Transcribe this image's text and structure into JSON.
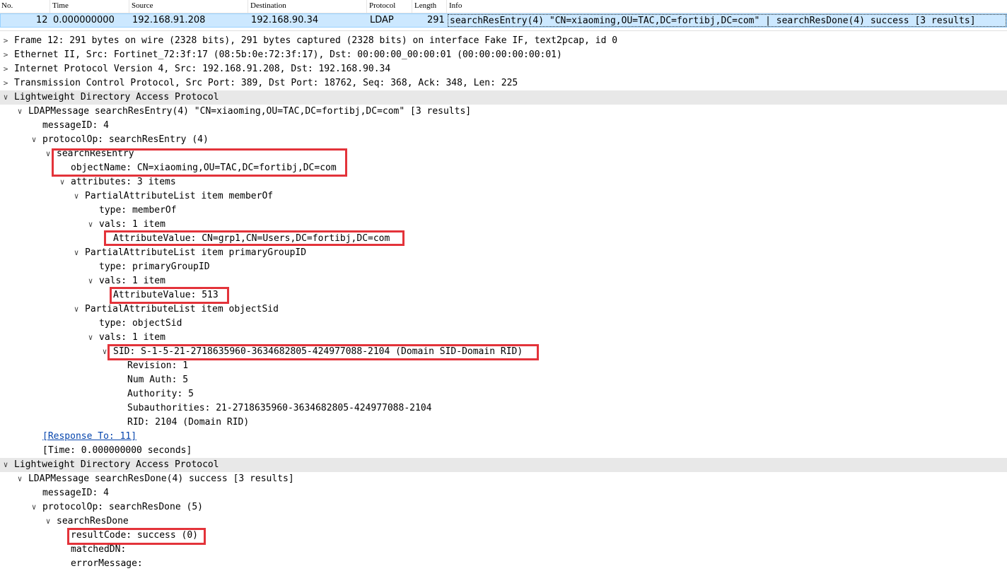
{
  "packet_list": {
    "headers": [
      "No.",
      "Time",
      "Source",
      "Destination",
      "Protocol",
      "Length",
      "Info"
    ],
    "selected_row": {
      "no": "12",
      "time": "0.000000000",
      "source": "192.168.91.208",
      "destination": "192.168.90.34",
      "protocol": "LDAP",
      "length": "291",
      "info": "searchResEntry(4) \"CN=xiaoming,OU=TAC,DC=fortibj,DC=com\"  | searchResDone(4) success  [3 results]"
    },
    "selected_bg": "#cce8ff"
  },
  "details": {
    "frame": "Frame 12: 291 bytes on wire (2328 bits), 291 bytes captured (2328 bits) on interface Fake IF, text2pcap, id 0",
    "ethernet": "Ethernet II, Src: Fortinet_72:3f:17 (08:5b:0e:72:3f:17), Dst: 00:00:00_00:00:01 (00:00:00:00:00:01)",
    "ip": "Internet Protocol Version 4, Src: 192.168.91.208, Dst: 192.168.90.34",
    "tcp": "Transmission Control Protocol, Src Port: 389, Dst Port: 18762, Seq: 368, Ack: 348, Len: 225",
    "ldap1": "Lightweight Directory Access Protocol",
    "ldap1_msg": "LDAPMessage searchResEntry(4) \"CN=xiaoming,OU=TAC,DC=fortibj,DC=com\" [3 results]",
    "ldap1_msgid": "messageID: 4",
    "ldap1_protocolop": "protocolOp: searchResEntry (4)",
    "search_res_entry": "searchResEntry",
    "object_name": "objectName: CN=xiaoming,OU=TAC,DC=fortibj,DC=com",
    "attributes": "attributes: 3 items",
    "pal_memberof": "PartialAttributeList item memberOf",
    "type_memberof": "type: memberOf",
    "vals1": "vals: 1 item",
    "attr_value_group": "AttributeValue: CN=grp1,CN=Users,DC=fortibj,DC=com",
    "pal_primarygroup": "PartialAttributeList item primaryGroupID",
    "type_primarygroup": "type: primaryGroupID",
    "vals2": "vals: 1 item",
    "attr_value_513": "AttributeValue: 513",
    "pal_objectsid": "PartialAttributeList item objectSid",
    "type_objectsid": "type: objectSid",
    "vals3": "vals: 1 item",
    "sid": "SID: S-1-5-21-2718635960-3634682805-424977088-2104  (Domain SID-Domain RID)",
    "revision": "Revision: 1",
    "num_auth": "Num Auth: 5",
    "authority": "Authority: 5",
    "subauthorities": "Subauthorities: 21-2718635960-3634682805-424977088-2104",
    "rid": "RID: 2104  (Domain RID)",
    "response_to": "[Response To: 11]",
    "time": "[Time: 0.000000000 seconds]",
    "ldap2": "Lightweight Directory Access Protocol",
    "ldap2_msg": "LDAPMessage searchResDone(4) success [3 results]",
    "ldap2_msgid": "messageID: 4",
    "ldap2_protocolop": "protocolOp: searchResDone (5)",
    "search_res_done": "searchResDone",
    "result_code": "resultCode: success (0)",
    "matched_dn": "matchedDN:",
    "error_message": "errorMessage:"
  },
  "highlight_color": "#e3333a"
}
